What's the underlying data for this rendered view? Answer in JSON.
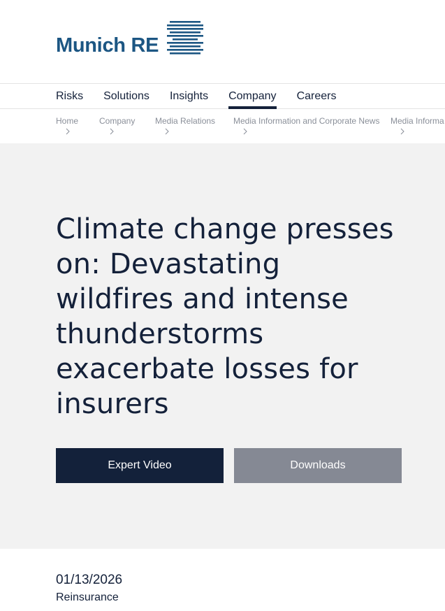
{
  "brand": {
    "name": "Munich RE",
    "color": "#1c5683"
  },
  "main_nav": {
    "items": [
      {
        "label": "Risks",
        "active": false
      },
      {
        "label": "Solutions",
        "active": false
      },
      {
        "label": "Insights",
        "active": false
      },
      {
        "label": "Company",
        "active": true
      },
      {
        "label": "Careers",
        "active": false
      }
    ]
  },
  "breadcrumb": {
    "items": [
      {
        "label": "Home"
      },
      {
        "label": "Company"
      },
      {
        "label": "Media Relations"
      },
      {
        "label": "Media Information and Corporate News"
      },
      {
        "label": "Media Informa"
      }
    ]
  },
  "hero": {
    "title": "Climate change presses on: Devastating wildfires and intense thunderstorms exacerbate losses for insurers",
    "buttons": {
      "video_label": "Expert Video",
      "downloads_label": "Downloads"
    }
  },
  "article_meta": {
    "date": "01/13/2026",
    "category": "Reinsurance"
  },
  "colors": {
    "primary_dark": "#13213a",
    "secondary_button": "#858994",
    "hero_background": "#f2f2f2",
    "breadcrumb_text": "#8a8f99"
  },
  "icons": {
    "logo_mark": "munich-re-logo-mark",
    "breadcrumb_separator": "chevron-right-icon"
  }
}
